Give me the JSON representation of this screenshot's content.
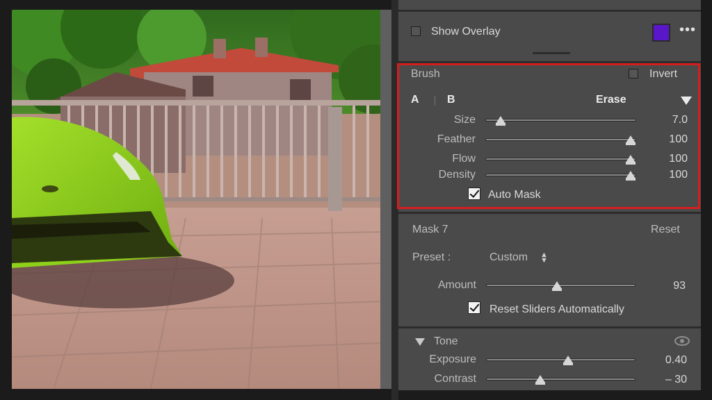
{
  "overlay": {
    "label": "Show Overlay",
    "color": "#5a17c9",
    "more_icon": "more-icon"
  },
  "brush": {
    "title": "Brush",
    "invert_label": "Invert",
    "tab_a": "A",
    "tab_b": "B",
    "erase": "Erase",
    "sliders": [
      {
        "label": "Size",
        "value": "7.0",
        "level": 0.05
      },
      {
        "label": "Feather",
        "value": "100",
        "level": 1.0
      },
      {
        "label": "Flow",
        "value": "100",
        "level": 1.0
      },
      {
        "label": "Density",
        "value": "100",
        "level": 1.0
      }
    ],
    "auto_mask": "Auto Mask"
  },
  "mask": {
    "title": "Mask 7",
    "reset": "Reset",
    "preset_label": "Preset :",
    "preset_value": "Custom",
    "amount_label": "Amount",
    "amount_value": "93",
    "amount_level": 0.47,
    "reset_sliders": "Reset Sliders Automatically"
  },
  "tone": {
    "title": "Tone",
    "sliders": [
      {
        "label": "Exposure",
        "value": "0.40",
        "level": 0.55
      },
      {
        "label": "Contrast",
        "value": "– 30",
        "level": 0.35
      }
    ]
  },
  "colors": {
    "highlight_box": "#d41e1e",
    "car": "#8ed11a"
  }
}
